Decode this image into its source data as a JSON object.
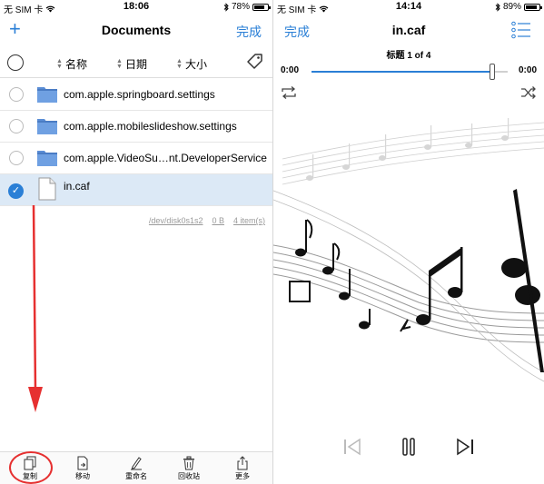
{
  "left": {
    "status": {
      "carrier": "无 SIM 卡",
      "time": "18:06",
      "battery": "78%",
      "battery_level": 0.78
    },
    "nav": {
      "add": "+",
      "title": "Documents",
      "done": "完成"
    },
    "sort": {
      "name": "名称",
      "date": "日期",
      "size": "大小"
    },
    "files": [
      {
        "name": "com.apple.springboard.settings",
        "type": "folder",
        "selected": false
      },
      {
        "name": "com.apple.mobileslideshow.settings",
        "type": "folder",
        "selected": false
      },
      {
        "name": "com.apple.VideoSu…nt.DeveloperService",
        "type": "folder",
        "selected": false
      },
      {
        "name": "in.caf",
        "type": "file",
        "selected": true
      }
    ],
    "footer": {
      "path": "/dev/disk0s1s2",
      "size": "0 B",
      "count": "4 item(s)"
    },
    "toolbar": [
      {
        "label": "复制",
        "icon": "copy-icon"
      },
      {
        "label": "移动",
        "icon": "move-icon"
      },
      {
        "label": "重命名",
        "icon": "rename-icon"
      },
      {
        "label": "回收站",
        "icon": "trash-icon"
      },
      {
        "label": "更多",
        "icon": "share-icon"
      }
    ],
    "accent": "#2a7fd6",
    "annotation_color": "#e63030"
  },
  "right": {
    "status": {
      "carrier": "无 SIM 卡",
      "time": "14:14",
      "battery": "89%",
      "battery_level": 0.89
    },
    "nav": {
      "done": "完成",
      "title": "in.caf"
    },
    "track": "标题 1 of 4",
    "time_elapsed": "0:00",
    "time_remaining": "0:00",
    "progress": 0.92
  }
}
